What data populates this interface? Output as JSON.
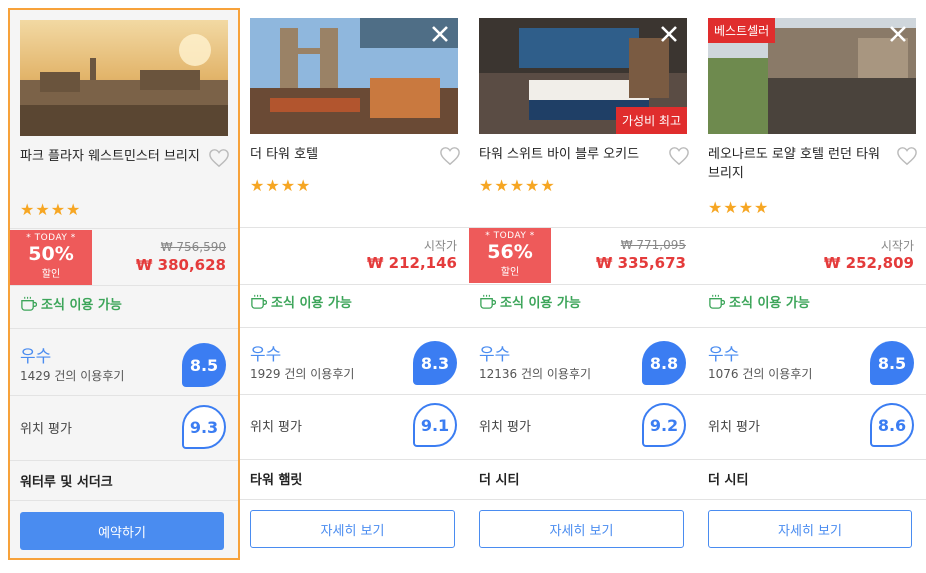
{
  "cards": [
    {
      "name": "파크 플라자 웨스트민스터 브리지",
      "stars": "★★★★",
      "today_label": "* TODAY *",
      "discount": "50%",
      "discount_suffix": "할인",
      "original_price": "₩ 756,590",
      "price": "₩ 380,628",
      "breakfast": "조식 이용 가능",
      "rating_word": "우수",
      "review_count": "1429 건의 이용후기",
      "score": "8.5",
      "location_label": "위치 평가",
      "location_score": "9.3",
      "district": "워터루 및 서더크",
      "button": "예약하기"
    },
    {
      "name": "더 타워 호텔",
      "stars": "★★★★",
      "price_from": "시작가",
      "price": "₩ 212,146",
      "breakfast": "조식 이용 가능",
      "rating_word": "우수",
      "review_count": "1929 건의 이용후기",
      "score": "8.3",
      "location_label": "위치 평가",
      "location_score": "9.1",
      "district": "타워 햄릿",
      "button": "자세히 보기"
    },
    {
      "name": "타워 스위트 바이 블루 오키드",
      "stars": "★★★★★",
      "badge_value": "가성비 최고",
      "today_label": "* TODAY *",
      "discount": "56%",
      "discount_suffix": "할인",
      "original_price": "₩ 771,095",
      "price": "₩ 335,673",
      "breakfast": "조식 이용 가능",
      "rating_word": "우수",
      "review_count": "12136 건의 이용후기",
      "score": "8.8",
      "location_label": "위치 평가",
      "location_score": "9.2",
      "district": "더 시티",
      "button": "자세히 보기"
    },
    {
      "name": "레오나르도 로얄 호텔 런던 타워 브리지",
      "stars": "★★★★",
      "badge_best": "베스트셀러",
      "price_from": "시작가",
      "price": "₩ 252,809",
      "breakfast": "조식 이용 가능",
      "rating_word": "우수",
      "review_count": "1076 건의 이용후기",
      "score": "8.5",
      "location_label": "위치 평가",
      "location_score": "8.6",
      "district": "더 시티",
      "button": "자세히 보기"
    }
  ],
  "colors": {
    "accent_blue": "#4a8cf0",
    "discount_red": "#ee5a5a",
    "price_red": "#e43b3b",
    "star_orange": "#f6a623",
    "breakfast_green": "#3da55a",
    "selected_border": "#f7a23a"
  },
  "icons": [
    "close-icon",
    "heart-icon",
    "coffee-cup-icon",
    "star-icon"
  ]
}
